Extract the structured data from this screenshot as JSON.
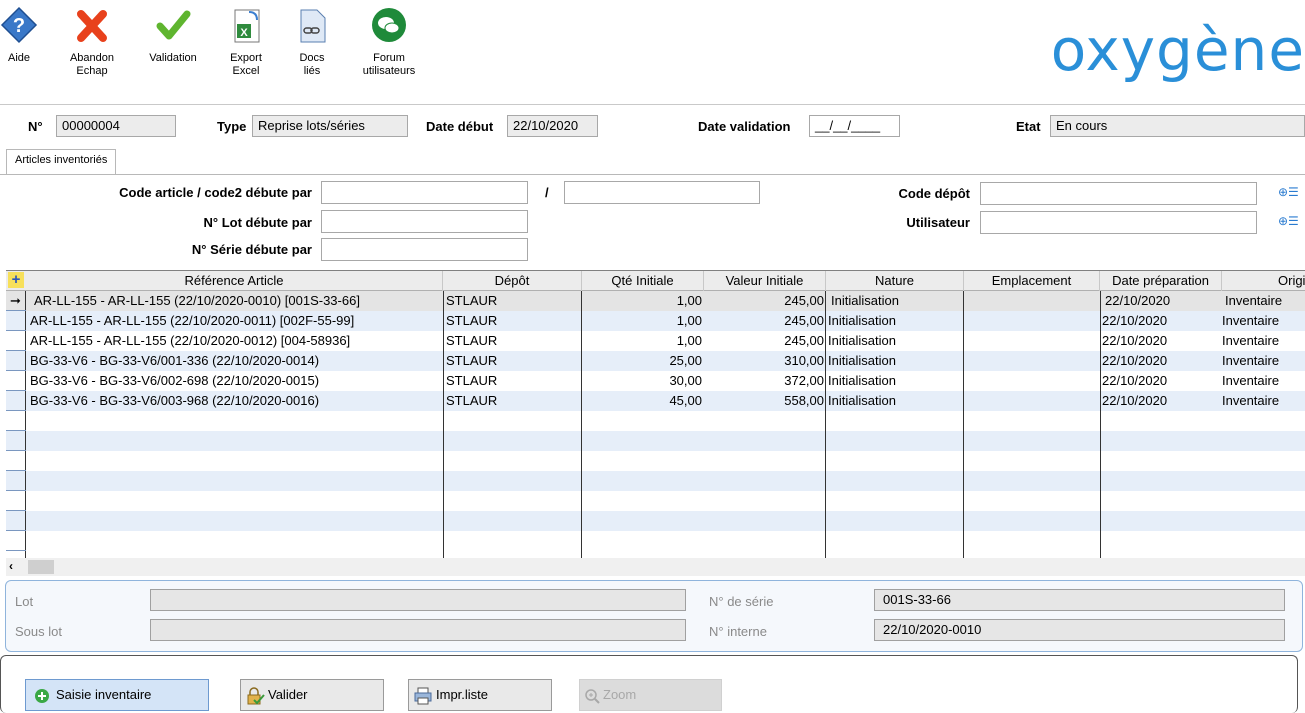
{
  "toolbar": {
    "aide": "Aide",
    "abandon_l1": "Abandon",
    "abandon_l2": "Echap",
    "validation": "Validation",
    "export_l1": "Export",
    "export_l2": "Excel",
    "docs_l1": "Docs",
    "docs_l2": "liés",
    "forum_l1": "Forum",
    "forum_l2": "utilisateurs"
  },
  "logo": "oxygène",
  "header": {
    "num_label": "N°",
    "num_value": "00000004",
    "type_label": "Type",
    "type_value": "Reprise lots/séries",
    "date_debut_label": "Date début",
    "date_debut_value": "22/10/2020",
    "date_validation_label": "Date validation",
    "date_validation_value": "__/__/____",
    "etat_label": "Etat",
    "etat_value": "En cours"
  },
  "tab": {
    "label": "Articles inventoriés"
  },
  "filters": {
    "code_article_label": "Code article / code2 débute par",
    "slash": "/",
    "lot_label": "N° Lot débute par",
    "serie_label": "N° Série débute par",
    "depot_label": "Code dépôt",
    "utilisateur_label": "Utilisateur",
    "lookup_glyph": "⊕☰"
  },
  "grid": {
    "columns": [
      "Référence Article",
      "Dépôt",
      "Qté Initiale",
      "Valeur Initiale",
      "Nature",
      "Emplacement",
      "Date préparation",
      "Origine"
    ],
    "rows": [
      [
        "AR-LL-155 - AR-LL-155 (22/10/2020-0010) [001S-33-66]",
        "STLAUR",
        "1,00",
        "245,00",
        "Initialisation",
        "",
        "22/10/2020",
        "Inventaire"
      ],
      [
        "AR-LL-155 - AR-LL-155 (22/10/2020-0011) [002F-55-99]",
        "STLAUR",
        "1,00",
        "245,00",
        "Initialisation",
        "",
        "22/10/2020",
        "Inventaire"
      ],
      [
        "AR-LL-155 - AR-LL-155 (22/10/2020-0012) [004-58936]",
        "STLAUR",
        "1,00",
        "245,00",
        "Initialisation",
        "",
        "22/10/2020",
        "Inventaire"
      ],
      [
        "BG-33-V6 - BG-33-V6/001-336 (22/10/2020-0014)",
        "STLAUR",
        "25,00",
        "310,00",
        "Initialisation",
        "",
        "22/10/2020",
        "Inventaire"
      ],
      [
        "BG-33-V6 - BG-33-V6/002-698 (22/10/2020-0015)",
        "STLAUR",
        "30,00",
        "372,00",
        "Initialisation",
        "",
        "22/10/2020",
        "Inventaire"
      ],
      [
        "BG-33-V6 - BG-33-V6/003-968 (22/10/2020-0016)",
        "STLAUR",
        "45,00",
        "558,00",
        "Initialisation",
        "",
        "22/10/2020",
        "Inventaire"
      ]
    ]
  },
  "detail": {
    "lot_label": "Lot",
    "sous_lot_label": "Sous lot",
    "serie_label": "N° de série",
    "serie_value": "001S-33-66",
    "interne_label": "N° interne",
    "interne_value": "22/10/2020-0010"
  },
  "buttons": {
    "saisie": "Saisie inventaire",
    "valider": "Valider",
    "impr": "Impr.liste",
    "zoom": "Zoom"
  }
}
